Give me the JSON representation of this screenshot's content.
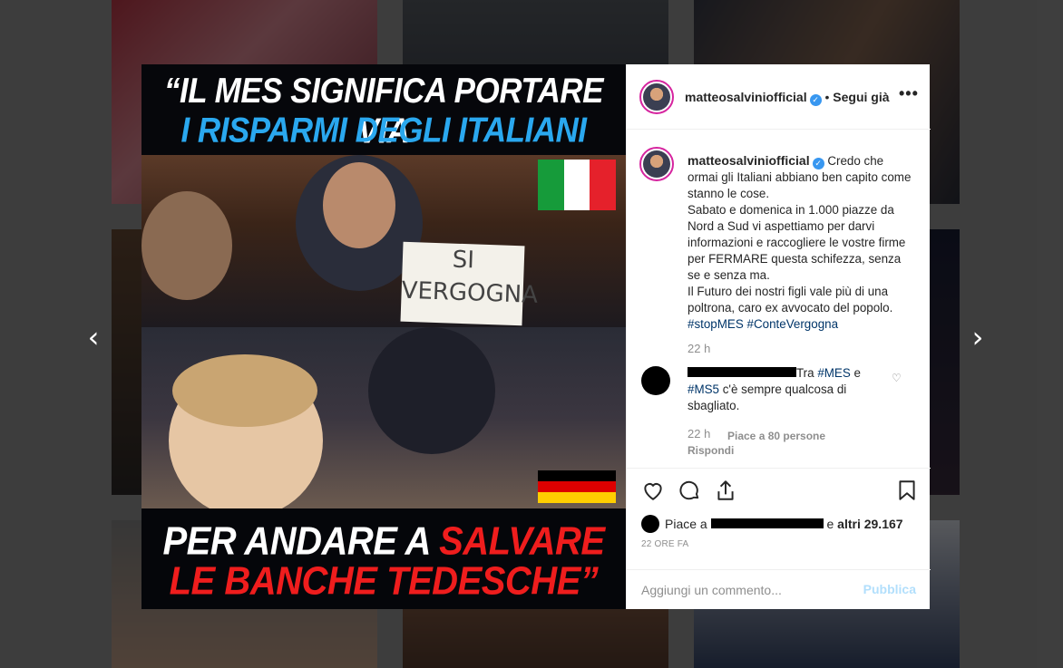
{
  "colors": {
    "instagram_blue": "#3897f0",
    "hashtag": "#003569",
    "muted": "#8e8e8e",
    "publish_disabled": "#b2dffc",
    "poster_blue": "#2aa8ef",
    "poster_red": "#ef1d1d"
  },
  "nav": {
    "prev_icon": "chevron-left-icon",
    "next_icon": "chevron-right-icon"
  },
  "poster": {
    "headline_line1": "“IL MES SIGNIFICA PORTARE VIA",
    "headline_line2": "I RISPARMI DEGLI ITALIANI",
    "sign_text": "SI VERGOGNA",
    "footer_line1_white": "PER ANDARE A ",
    "footer_line1_red": "SALVARE",
    "footer_line2": "LE BANCHE TEDESCHE”"
  },
  "header": {
    "username": "matteosalviniofficial",
    "separator": " • ",
    "follow_status": "Segui già",
    "more_icon": "•••"
  },
  "caption": {
    "username": "matteosalviniofficial",
    "lines": [
      "Credo che ormai gli Italiani abbiano ben capito come stanno le cose.",
      "Sabato e domenica in 1.000 piazze da Nord a Sud vi aspettiamo per darvi informazioni e raccogliere le vostre firme per FERMARE questa schifezza, senza se e senza ma.",
      "Il Futuro dei nostri figli vale più di una poltrona, caro ex avvocato del popolo."
    ],
    "hashtags": [
      "#stopMES",
      "#ConteVergogna"
    ],
    "time": "22 h"
  },
  "comment": {
    "before": "Tra ",
    "tag1": "#MES",
    "middle": " e ",
    "tag2": "#MS5",
    "after": " c'è sempre qualcosa di sbagliato.",
    "time": "22 h",
    "likes": "Piace a 80 persone",
    "reply": "Rispondi"
  },
  "actions": {
    "likes_prefix": "Piace a ",
    "likes_conj": " e ",
    "likes_others": "altri 29.167",
    "posted_ago": "22 ORE FA"
  },
  "add_comment": {
    "placeholder": "Aggiungi un commento...",
    "publish": "Pubblica"
  }
}
